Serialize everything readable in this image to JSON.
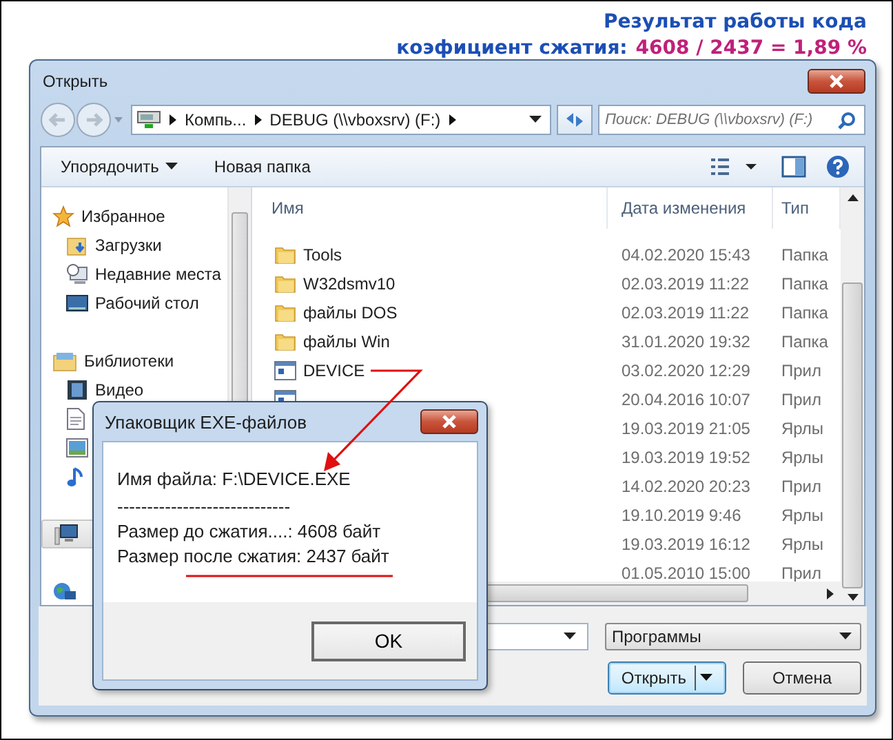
{
  "annotation": {
    "title": "Результат работы кода",
    "ratio_label": "коэфициент сжатия:",
    "ratio_value": "4608 / 2437 = 1,89 %"
  },
  "window": {
    "title": "Открыть"
  },
  "address": {
    "crumbs": [
      "Компь...",
      "DEBUG (\\\\vboxsrv) (F:)"
    ]
  },
  "search": {
    "placeholder": "Поиск: DEBUG (\\\\vboxsrv) (F:)"
  },
  "toolbar": {
    "organize": "Упорядочить",
    "new_folder": "Новая папка"
  },
  "sidebar": [
    {
      "kind": "group",
      "label": "Избранное",
      "selected": false
    },
    {
      "kind": "item",
      "label": "Загрузки",
      "selected": false
    },
    {
      "kind": "item",
      "label": "Недавние места",
      "selected": false
    },
    {
      "kind": "item",
      "label": "Рабочий стол",
      "selected": false
    },
    {
      "kind": "gap"
    },
    {
      "kind": "group",
      "label": "Библиотеки",
      "selected": false
    },
    {
      "kind": "item",
      "label": "Видео",
      "selected": false
    },
    {
      "kind": "item",
      "selected": false
    },
    {
      "kind": "item",
      "selected": false
    },
    {
      "kind": "item",
      "selected": false
    },
    {
      "kind": "gap"
    },
    {
      "kind": "group",
      "selected": true
    },
    {
      "kind": "gap"
    },
    {
      "kind": "group",
      "selected": false
    }
  ],
  "files": {
    "columns": [
      "Имя",
      "Дата изменения",
      "Тип"
    ],
    "rows": [
      {
        "kind": "folder",
        "name": "Tools",
        "date": "04.02.2020 15:43",
        "type": "Папка"
      },
      {
        "kind": "folder",
        "name": "W32dsmv10",
        "date": "02.03.2019 11:22",
        "type": "Папка"
      },
      {
        "kind": "folder",
        "name": "файлы DOS",
        "date": "02.03.2019 11:22",
        "type": "Папка"
      },
      {
        "kind": "folder",
        "name": "файлы Win",
        "date": "31.01.2020 19:32",
        "type": "Папка"
      },
      {
        "kind": "app",
        "name": "DEVICE",
        "date": "03.02.2020 12:29",
        "type": "Прил"
      },
      {
        "kind": "app",
        "date": "20.04.2016 10:07",
        "type": "Прил"
      },
      {
        "date": "19.03.2019 21:05",
        "type": "Ярлы"
      },
      {
        "date": "19.03.2019 19:52",
        "type": "Ярлы"
      },
      {
        "date": "14.02.2020 20:23",
        "type": "Прил"
      },
      {
        "date": "19.10.2019 9:46",
        "type": "Ярлы"
      },
      {
        "date": "19.03.2019 16:12",
        "type": "Ярлы"
      },
      {
        "date": "01.05.2010 15:00",
        "type": "Прил"
      }
    ]
  },
  "filter": {
    "value": "Программы"
  },
  "buttons": [
    {
      "label": "Открыть",
      "default": true,
      "split": true
    },
    {
      "label": "Отмена",
      "default": false,
      "split": false
    }
  ],
  "message": {
    "title": "Упаковщик EXE-файлов",
    "lines": [
      "Имя файла: F:\\DEVICE.EXE",
      "-----------------------------",
      "Размер до сжатия....: 4608 байт",
      "Размер после сжатия: 2437 байт"
    ],
    "button": "OK"
  }
}
